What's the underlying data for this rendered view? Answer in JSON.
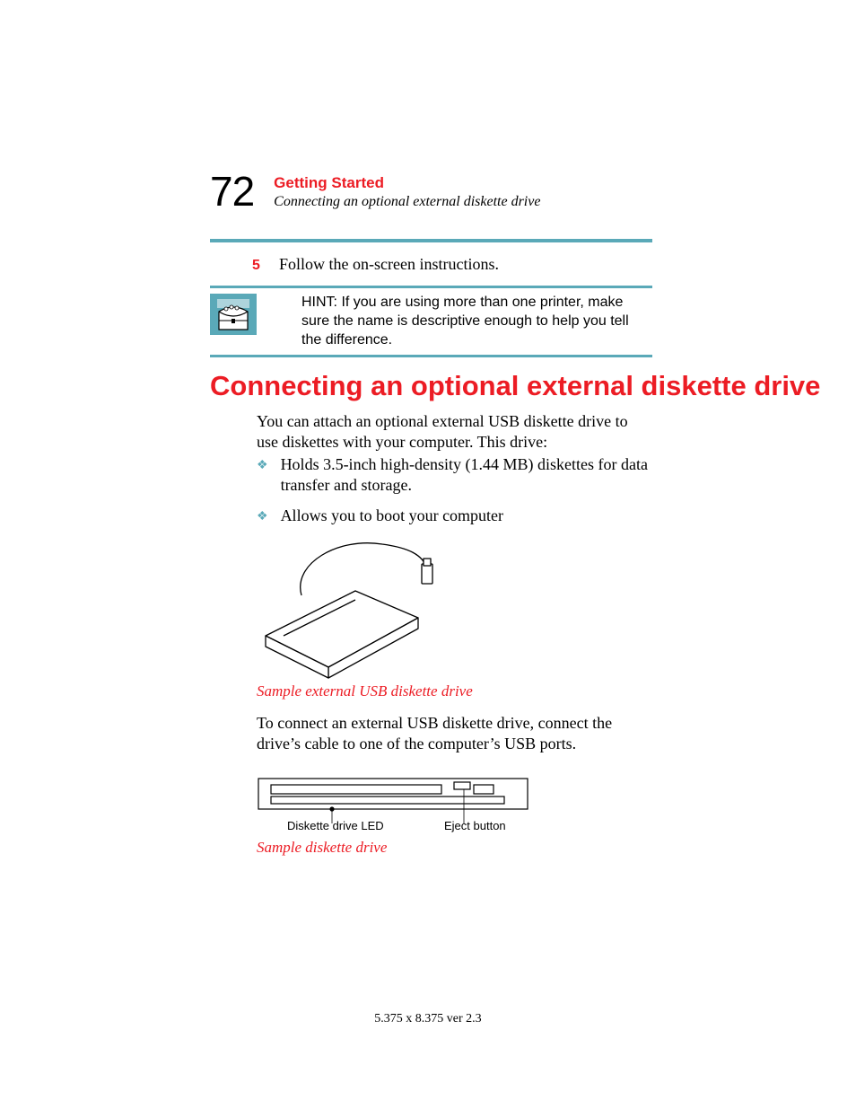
{
  "header": {
    "page_number": "72",
    "chapter": "Getting Started",
    "section": "Connecting an optional external diskette drive"
  },
  "step": {
    "num": "5",
    "text": "Follow the on-screen instructions."
  },
  "hint": {
    "text": "HINT: If you are using more than one printer, make sure the name is descriptive enough to help you tell the difference."
  },
  "heading": "Connecting an optional external diskette drive",
  "intro": "You can attach an optional external USB diskette drive to use diskettes with your computer. This drive:",
  "bullets": [
    "Holds 3.5-inch high-density (1.44 MB) diskettes for data transfer and storage.",
    "Allows you to boot your computer"
  ],
  "fig1_caption": "Sample external USB diskette drive",
  "connect_para": "To connect an external USB diskette drive, connect the drive’s cable to one of the computer’s USB ports.",
  "fig2_labels": {
    "led": "Diskette drive LED",
    "eject": "Eject button"
  },
  "fig2_caption": "Sample diskette drive",
  "footer": "5.375 x 8.375 ver 2.3"
}
